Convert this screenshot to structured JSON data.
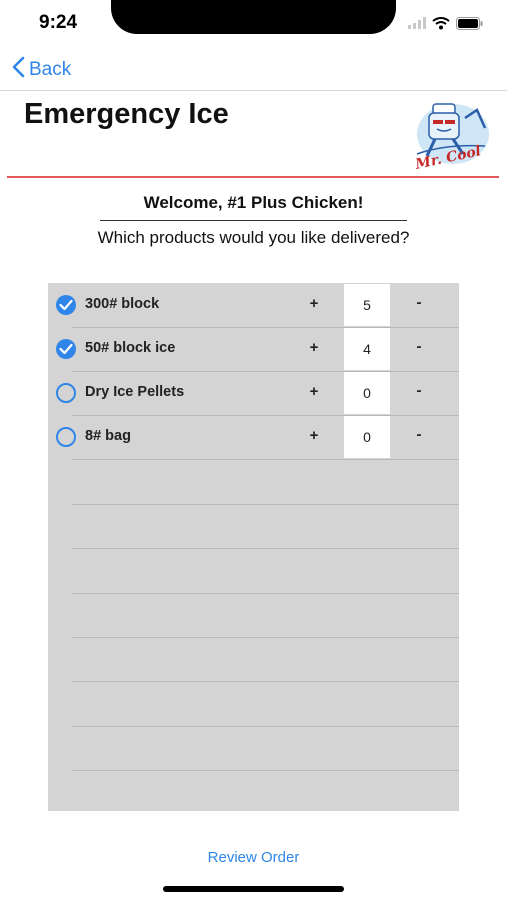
{
  "status_bar": {
    "time": "9:24"
  },
  "nav": {
    "back_label": "Back"
  },
  "page": {
    "title": "Emergency Ice",
    "logo_text": "Mr. Cool",
    "welcome": "Welcome, #1 Plus Chicken!",
    "question": "Which products would you like delivered?"
  },
  "products": [
    {
      "name": "300# block",
      "qty": "5",
      "selected": true
    },
    {
      "name": "50# block ice",
      "qty": "4",
      "selected": true
    },
    {
      "name": "Dry Ice Pellets",
      "qty": "0",
      "selected": false
    },
    {
      "name": "8# bag",
      "qty": "0",
      "selected": false
    }
  ],
  "controls": {
    "plus": "+",
    "minus": "-"
  },
  "footer": {
    "review_label": "Review Order"
  },
  "colors": {
    "accent": "#2f86e8",
    "rule": "#e2575a",
    "table_bg": "#d4d4d4"
  }
}
